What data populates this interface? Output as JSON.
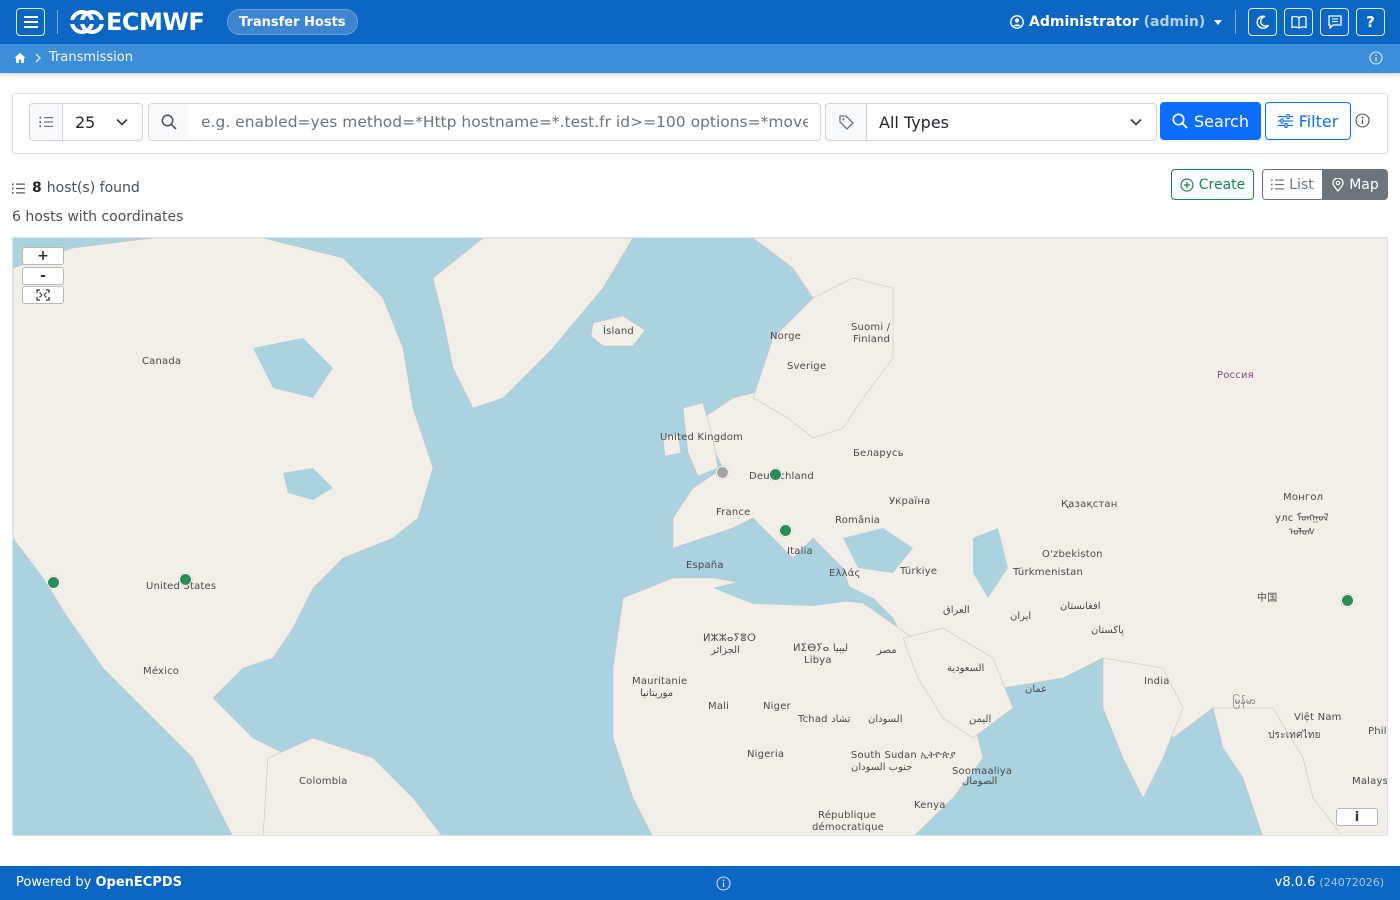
{
  "navbar": {
    "brand": "ECMWF",
    "section_pill": "Transfer Hosts",
    "user_name": "Administrator",
    "user_role": "(admin)",
    "icons": [
      "menu-icon",
      "moon-icon",
      "book-icon",
      "chat-icon",
      "help-icon"
    ],
    "help_label": "?"
  },
  "breadcrumb": {
    "items": [
      "Transmission"
    ]
  },
  "search": {
    "page_size": "25",
    "query_placeholder": "e.g. enabled=yes method=*Http hostname=*.test.fr id>=100 options=*mover*",
    "type_select": "All Types",
    "search_label": "Search",
    "filter_label": "Filter"
  },
  "results": {
    "count": "8",
    "count_suffix": "host(s) found",
    "coords_text": "6 hosts with coordinates",
    "create_label": "Create",
    "list_label": "List",
    "map_label": "Map"
  },
  "map": {
    "zoom_in": "+",
    "zoom_out": "-",
    "attribution_label": "i",
    "labels": [
      {
        "text": "Canada"
      },
      {
        "text": "United States"
      },
      {
        "text": "México"
      },
      {
        "text": "Colombia"
      },
      {
        "text": "Ísland"
      },
      {
        "text": "Norge"
      },
      {
        "text": "Sverige"
      },
      {
        "text": "Suomi /"
      },
      {
        "text": "Finland"
      },
      {
        "text": "United Kingdom"
      },
      {
        "text": "Deutschland"
      },
      {
        "text": "France"
      },
      {
        "text": "España"
      },
      {
        "text": "Italia"
      },
      {
        "text": "Ελλάς"
      },
      {
        "text": "România"
      },
      {
        "text": "Україна"
      },
      {
        "text": "Беларусь"
      },
      {
        "text": "Türkiye"
      },
      {
        "text": "Россия"
      },
      {
        "text": "Қазақстан"
      },
      {
        "text": "O'zbekiston"
      },
      {
        "text": "Türkmenistan"
      },
      {
        "text": "Монгол"
      },
      {
        "text": "улс ᠮᠣᠩᠭᠣᠯ"
      },
      {
        "text": "ᠤᠯᠤᠰ"
      },
      {
        "text": "中国"
      },
      {
        "text": "ایران"
      },
      {
        "text": "العراق"
      },
      {
        "text": "افغانستان"
      },
      {
        "text": "پاکستان"
      },
      {
        "text": "India"
      },
      {
        "text": "ⵍⵣⵣⴰⵢⴻⵔ"
      },
      {
        "text": "الجزائر"
      },
      {
        "text": "ⵍⵉⴱⵢⴰ ليبيا"
      },
      {
        "text": "Libya"
      },
      {
        "text": "مصر"
      },
      {
        "text": "Mauritanie"
      },
      {
        "text": "موريتانيا"
      },
      {
        "text": "Mali"
      },
      {
        "text": "Niger"
      },
      {
        "text": "Tchad تشاد"
      },
      {
        "text": "السودان"
      },
      {
        "text": "السعودية"
      },
      {
        "text": "عمان"
      },
      {
        "text": "اليمن"
      },
      {
        "text": "Nigeria"
      },
      {
        "text": "South Sudan ኢትዮጵያ"
      },
      {
        "text": "جنوب السودان"
      },
      {
        "text": "Soomaaliya"
      },
      {
        "text": "الصومال"
      },
      {
        "text": "Kenya"
      },
      {
        "text": "République"
      },
      {
        "text": "démocratique"
      },
      {
        "text": "မြန်မာ"
      },
      {
        "text": "Việt Nam"
      },
      {
        "text": "ประเทศไทย"
      },
      {
        "text": "Phil"
      },
      {
        "text": "Malaysi"
      }
    ],
    "markers": [
      {
        "status": "ok",
        "color": "#2e8b57"
      },
      {
        "status": "ok",
        "color": "#2e8b57"
      },
      {
        "status": "unknown",
        "color": "#a6a6a6"
      },
      {
        "status": "ok",
        "color": "#2e8b57"
      },
      {
        "status": "ok",
        "color": "#2e8b57"
      },
      {
        "status": "ok",
        "color": "#2e8b57"
      }
    ]
  },
  "footer": {
    "powered_prefix": "Powered by",
    "powered_brand": "OpenECPDS",
    "version": "v8.0.6",
    "build": "(24072026)"
  },
  "colors": {
    "primary": "#0b66c4",
    "accent": "#0d6efd",
    "success": "#198754",
    "sea": "#aad3df",
    "land": "#f2efe9"
  }
}
